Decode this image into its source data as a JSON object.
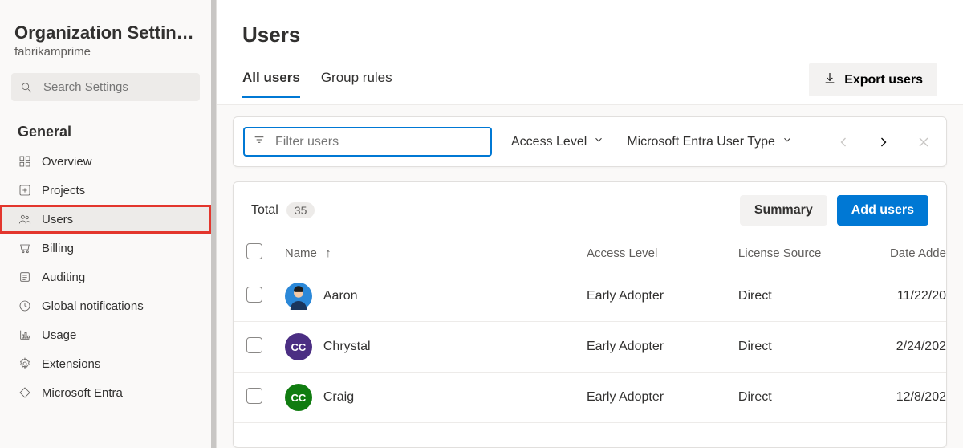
{
  "sidebar": {
    "title": "Organization Settin…",
    "subtitle": "fabrikamprime",
    "search_placeholder": "Search Settings",
    "section_label": "General",
    "items": [
      {
        "label": "Overview",
        "icon": "grid-icon"
      },
      {
        "label": "Projects",
        "icon": "plus-box-icon"
      },
      {
        "label": "Users",
        "icon": "people-icon",
        "active": true,
        "highlighted": true
      },
      {
        "label": "Billing",
        "icon": "cart-icon"
      },
      {
        "label": "Auditing",
        "icon": "list-icon"
      },
      {
        "label": "Global notifications",
        "icon": "clock-icon"
      },
      {
        "label": "Usage",
        "icon": "chart-icon"
      },
      {
        "label": "Extensions",
        "icon": "gear-icon"
      },
      {
        "label": "Microsoft Entra",
        "icon": "diamond-icon"
      }
    ]
  },
  "header": {
    "title": "Users",
    "tabs": [
      {
        "label": "All users",
        "active": true
      },
      {
        "label": "Group rules"
      }
    ],
    "export_label": "Export users"
  },
  "filters": {
    "placeholder": "Filter users",
    "access_level_label": "Access Level",
    "user_type_label": "Microsoft Entra User Type"
  },
  "table": {
    "total_label": "Total",
    "total_count": "35",
    "summary_label": "Summary",
    "add_users_label": "Add users",
    "columns": {
      "name": "Name",
      "access": "Access Level",
      "source": "License Source",
      "date": "Date Adde"
    },
    "rows": [
      {
        "name": "Aaron",
        "access": "Early Adopter",
        "source": "Direct",
        "date": "11/22/20",
        "avatar_bg": "#2b88d8",
        "initials": "",
        "avatar_type": "person"
      },
      {
        "name": "Chrystal",
        "access": "Early Adopter",
        "source": "Direct",
        "date": "2/24/202",
        "avatar_bg": "#4b2e83",
        "initials": "CC",
        "avatar_type": "initials"
      },
      {
        "name": "Craig",
        "access": "Early Adopter",
        "source": "Direct",
        "date": "12/8/202",
        "avatar_bg": "#107c10",
        "initials": "CC",
        "avatar_type": "initials"
      }
    ]
  }
}
